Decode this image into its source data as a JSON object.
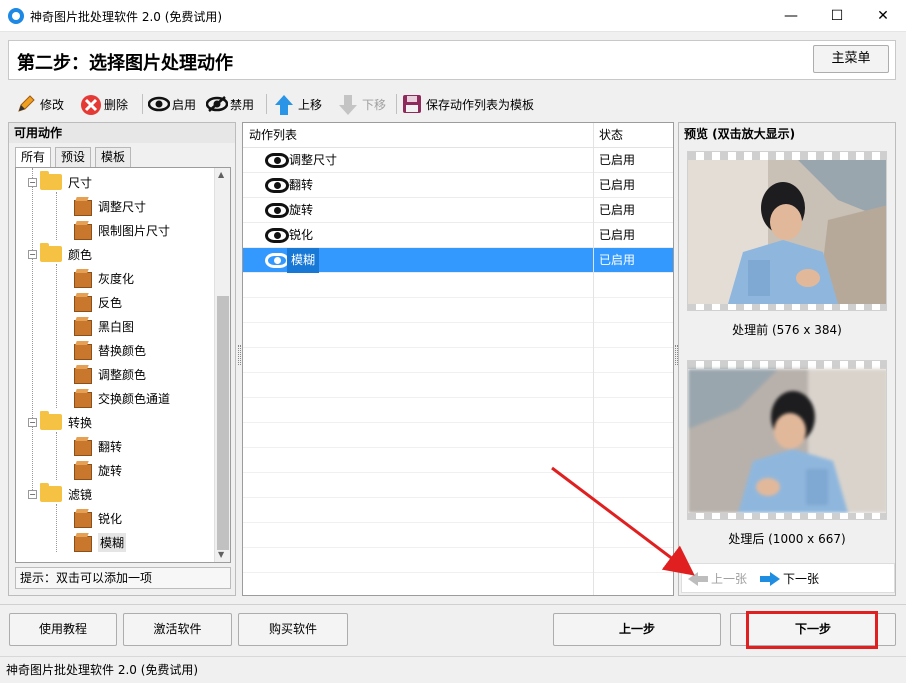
{
  "window": {
    "title": "神奇图片批处理软件 2.0 (免费试用)",
    "minimize": "—",
    "maximize": "☐",
    "close": "✕"
  },
  "header": {
    "step_title": "第二步：选择图片处理动作",
    "main_menu": "主菜单"
  },
  "toolbar": {
    "edit": "修改",
    "delete": "删除",
    "enable": "启用",
    "disable": "禁用",
    "move_up": "上移",
    "move_down": "下移",
    "save_template": "保存动作列表为模板"
  },
  "left": {
    "title": "可用动作",
    "tabs": [
      "所有",
      "预设",
      "模板"
    ],
    "tree": {
      "size": "尺寸",
      "resize": "调整尺寸",
      "limit_size": "限制图片尺寸",
      "color": "颜色",
      "grayscale": "灰度化",
      "invert": "反色",
      "bw": "黑白图",
      "replace_color": "替换颜色",
      "adjust_color": "调整颜色",
      "swap_channels": "交换颜色通道",
      "transform": "转换",
      "flip": "翻转",
      "rotate": "旋转",
      "filter": "滤镜",
      "sharpen": "锐化",
      "blur": "模糊"
    },
    "hint": "提示：双击可以添加一项"
  },
  "actions": {
    "col_name": "动作列表",
    "col_status": "状态",
    "rows": [
      {
        "name": "调整尺寸",
        "status": "已启用"
      },
      {
        "name": "翻转",
        "status": "已启用"
      },
      {
        "name": "旋转",
        "status": "已启用"
      },
      {
        "name": "锐化",
        "status": "已启用"
      },
      {
        "name": "模糊",
        "status": "已启用"
      }
    ]
  },
  "preview": {
    "title": "预览 (双击放大显示)",
    "before": "处理前 (576 x 384)",
    "after": "处理后 (1000 x 667)",
    "prev": "上一张",
    "next": "下一张"
  },
  "bottom": {
    "tutorial": "使用教程",
    "activate": "激活软件",
    "buy": "购买软件",
    "prev_step": "上一步",
    "next_step": "下一步"
  },
  "status_bar": "神奇图片批处理软件 2.0 (免费试用)",
  "colors": {
    "accent": "#3399ff",
    "annotation": "#e02020"
  }
}
